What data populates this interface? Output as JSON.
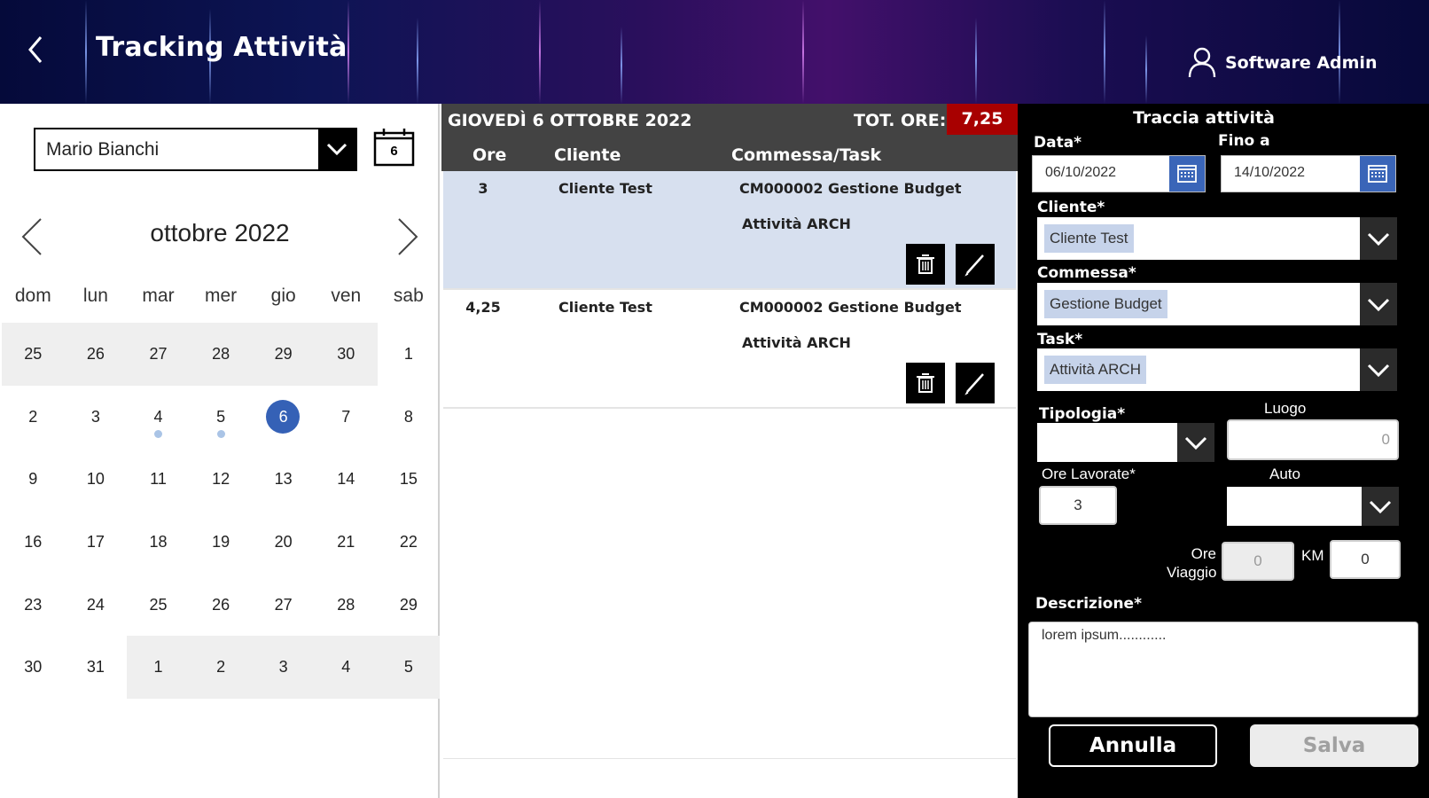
{
  "header": {
    "title": "Tracking Attività",
    "user_name": "Software Admin"
  },
  "left": {
    "person": "Mario Bianchi",
    "today_day": "6",
    "month_title": "ottobre 2022",
    "weekdays": [
      "dom",
      "lun",
      "mar",
      "mer",
      "gio",
      "ven",
      "sab"
    ],
    "days": [
      {
        "d": "25",
        "other": true
      },
      {
        "d": "26",
        "other": true
      },
      {
        "d": "27",
        "other": true
      },
      {
        "d": "28",
        "other": true
      },
      {
        "d": "29",
        "other": true
      },
      {
        "d": "30",
        "other": true
      },
      {
        "d": "1"
      },
      {
        "d": "2"
      },
      {
        "d": "3"
      },
      {
        "d": "4",
        "dot": true
      },
      {
        "d": "5",
        "dot": true
      },
      {
        "d": "6",
        "selected": true
      },
      {
        "d": "7"
      },
      {
        "d": "8"
      },
      {
        "d": "9"
      },
      {
        "d": "10"
      },
      {
        "d": "11"
      },
      {
        "d": "12"
      },
      {
        "d": "13"
      },
      {
        "d": "14"
      },
      {
        "d": "15"
      },
      {
        "d": "16"
      },
      {
        "d": "17"
      },
      {
        "d": "18"
      },
      {
        "d": "19"
      },
      {
        "d": "20"
      },
      {
        "d": "21"
      },
      {
        "d": "22"
      },
      {
        "d": "23"
      },
      {
        "d": "24"
      },
      {
        "d": "25"
      },
      {
        "d": "26"
      },
      {
        "d": "27"
      },
      {
        "d": "28"
      },
      {
        "d": "29"
      },
      {
        "d": "30"
      },
      {
        "d": "31"
      },
      {
        "d": "1",
        "other": true
      },
      {
        "d": "2",
        "other": true
      },
      {
        "d": "3",
        "other": true
      },
      {
        "d": "4",
        "other": true
      },
      {
        "d": "5",
        "other": true
      }
    ]
  },
  "middle": {
    "date_title": "GIOVEDÌ 6 OTTOBRE 2022",
    "tot_label": "TOT. ORE:",
    "tot_value": "7,25",
    "columns": {
      "ore": "Ore",
      "cliente": "Cliente",
      "commessa": "Commessa/Task"
    },
    "entries": [
      {
        "ore": "3",
        "cliente": "Cliente Test",
        "commessa": "CM000002 Gestione Budget",
        "task": "Attività ARCH"
      },
      {
        "ore": "4,25",
        "cliente": "Cliente Test",
        "commessa": "CM000002 Gestione Budget",
        "task": "Attività ARCH"
      }
    ]
  },
  "form": {
    "title": "Traccia attività",
    "data_label": "Data*",
    "data_value": "06/10/2022",
    "fino_label": "Fino a",
    "fino_value": "14/10/2022",
    "cliente_label": "Cliente*",
    "cliente_value": "Cliente Test",
    "commessa_label": "Commessa*",
    "commessa_value": "Gestione Budget",
    "task_label": "Task*",
    "task_value": "Attività ARCH",
    "tipologia_label": "Tipologia*",
    "luogo_label": "Luogo",
    "luogo_value": "0",
    "ore_lavorate_label": "Ore Lavorate*",
    "ore_lavorate_value": "3",
    "auto_label": "Auto",
    "ore_viaggio_label_1": "Ore",
    "ore_viaggio_label_2": "Viaggio",
    "ore_viaggio_value": "0",
    "km_label": "KM",
    "km_value": "0",
    "descrizione_label": "Descrizione*",
    "descrizione_value": "lorem ipsum............",
    "annulla_label": "Annulla",
    "salva_label": "Salva"
  },
  "colors": {
    "accent_blue": "#3561b6",
    "total_red": "#a80000",
    "selected_row": "#d7e0ef",
    "chip": "#c6d3ea"
  }
}
